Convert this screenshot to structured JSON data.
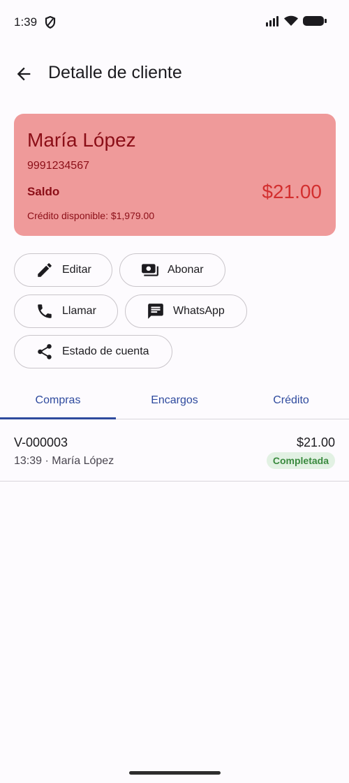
{
  "status_bar": {
    "time": "1:39"
  },
  "header": {
    "title": "Detalle de cliente"
  },
  "customer": {
    "name": "María López",
    "phone": "9991234567",
    "balance_label": "Saldo",
    "balance_value": "$21.00",
    "credit_available": "Crédito disponible: $1,979.00"
  },
  "actions": {
    "edit": "Editar",
    "pay": "Abonar",
    "call": "Llamar",
    "whatsapp": "WhatsApp",
    "statement": "Estado de cuenta"
  },
  "tabs": [
    {
      "label": "Compras",
      "selected": true
    },
    {
      "label": "Encargos",
      "selected": false
    },
    {
      "label": "Crédito",
      "selected": false
    }
  ],
  "purchases": [
    {
      "id": "V-000003",
      "subtitle": "13:39 · María López",
      "amount": "$21.00",
      "status": "Completada"
    }
  ],
  "colors": {
    "card_background": "#ef9a9a",
    "balance_text": "#d32f2f",
    "accent": "#2e4a9e",
    "status_completed": "#3a8a3f"
  },
  "icons": [
    "shield-icon",
    "signal-icon",
    "wifi-icon",
    "battery-icon",
    "back-arrow-icon",
    "pencil-icon",
    "cash-icon",
    "phone-icon",
    "chat-icon",
    "share-icon"
  ]
}
